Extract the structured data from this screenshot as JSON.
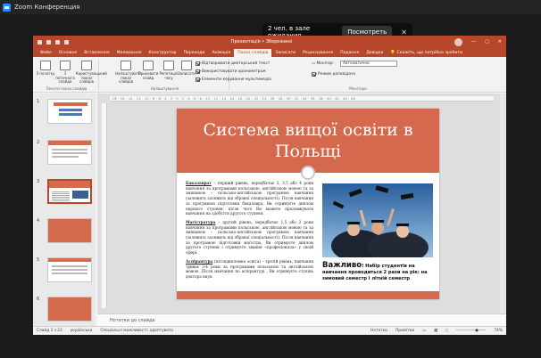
{
  "zoom": {
    "title": "Zoom Конференция",
    "waiting_text": "2 чел. в зале ожидания",
    "view_button": "Посмотреть",
    "close": "✕"
  },
  "ppt": {
    "title": "Презентація",
    "saved": "•  Збережено",
    "search_hint": "Скажіть, що потрібно зробити",
    "tabs": [
      "Файл",
      "Основне",
      "Вставлення",
      "Малювання",
      "Конструктор",
      "Переходи",
      "Анімація",
      "Показ слайдів",
      "Записати",
      "Рецензування",
      "Подання",
      "Довідка"
    ],
    "active_tab": "Показ слайдів",
    "ribbon": {
      "from_start": "З початку",
      "from_current": "З поточного слайда",
      "custom": "Користувацький показ слайдів",
      "group1": "Почати показ слайдів",
      "setup": "Налаштувати показ слайдів",
      "hide": "Приховати слайд",
      "rehearse": "Репетиція часу",
      "record": "Записати",
      "group2": "Налаштування",
      "chk_narration": "Відтворювати дикторський текст",
      "chk_timings": "Використовувати хронометраж",
      "chk_media": "Елементи керування мультимедіа",
      "monitor_label": "Монітор:",
      "monitor_value": "Автоматично",
      "presenter_view": "Режим доповідача",
      "group3": "Монітори"
    },
    "thumbs": [
      "1",
      "2",
      "3",
      "4",
      "5",
      "6"
    ],
    "slide": {
      "title": "Система вищої освіти в Польщі",
      "p1_term": "Бакалаврат",
      "p1": " – перший рівень, передбачає 3, 3,5 або 4 роки навчання за програмами польською, англійською мовою та за змішаною – польсько-англійською програмою навчання (залежить залежить від обраної спеціальності). Після навчання за програмою підготовки бакалавра, Ви отримуєте диплом першого ступеня, після чого Ви можете продовжувати навчання на здобуття другого ступеня.",
      "p2_term": "Магістратура",
      "p2": " – другий рівень, передбачає 1,5 або 2 роки навчання за програмами польською, англійською мовою та за змішаною – польсько-англійською програмою навчання (залежить залежить від обраної спеціальності). Після навчання за програмою підготовки магістра, Ви отримуєте диплом другого ступеня і отримуєте звання «професіонала» у своїй сфері.",
      "p3_term": "Аспірантура",
      "p3": " (післядипломна освіта) – третій рівень, навчання триває 3-4 роки за програмами польською та англійською мовою. Після навчання по аспірантурі , Ви отримуєте ступінь доктора наук.",
      "important_big": "Важливо",
      "important": "! Набір студентів на навчання проводиться 2 рази на рік: на зимовий семестр і літній семестр"
    },
    "notes": "Нотатки до слайда",
    "status": {
      "slide": "Слайд 3 з 23",
      "lang": "українська",
      "accessibility": "Спеціальні можливості: адаптувати",
      "notes": "Нотатки",
      "comments": "Примітки",
      "zoom": "74%"
    }
  }
}
